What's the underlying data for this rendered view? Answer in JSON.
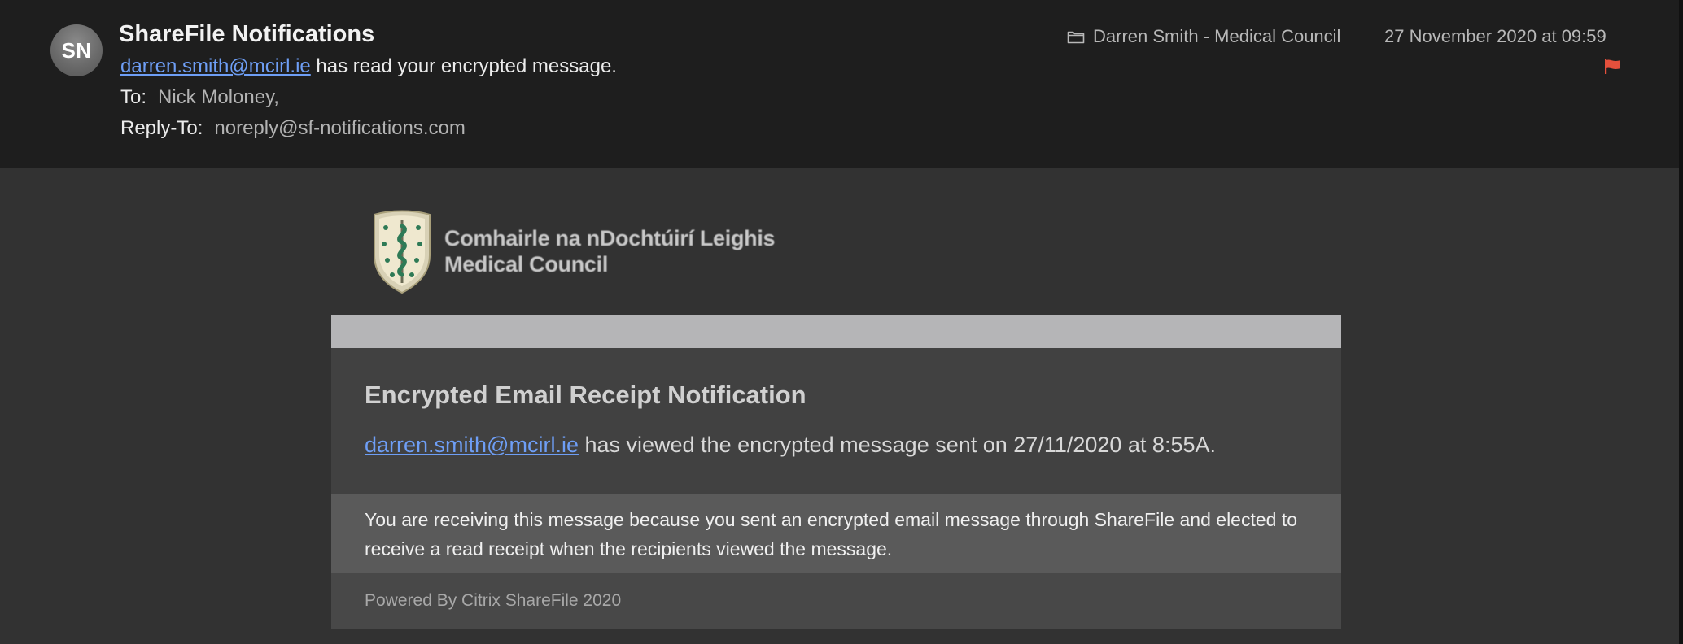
{
  "header": {
    "avatar_initials": "SN",
    "sender_name": "ShareFile Notifications",
    "subject_link": "darren.smith@mcirl.ie",
    "subject_rest": " has read your encrypted message.",
    "to_label": "To:",
    "to_value": "Nick Moloney,",
    "reply_to_label": "Reply-To:",
    "reply_to_value": "noreply@sf-notifications.com",
    "mailbox": "Darren Smith - Medical Council",
    "date": "27 November 2020 at 09:59",
    "flag_color": "#e5503c"
  },
  "logo": {
    "line1": "Comhairle na nDochtúirí Leighis",
    "line2": "Medical Council"
  },
  "card": {
    "title": "Encrypted Email Receipt Notification",
    "viewer_link": "darren.smith@mcirl.ie",
    "viewed_text": " has viewed the encrypted message sent on 27/11/2020 at 8:55A.",
    "note": "You are receiving this message because you sent an encrypted email message through ShareFile and elected to receive a read receipt when the recipients viewed the message.",
    "footer": "Powered By Citrix ShareFile 2020"
  },
  "colors": {
    "link": "#6e9ef5",
    "header_bg": "#1e1e1e",
    "body_bg": "#323232",
    "card_bar": "#b5b5b7"
  }
}
